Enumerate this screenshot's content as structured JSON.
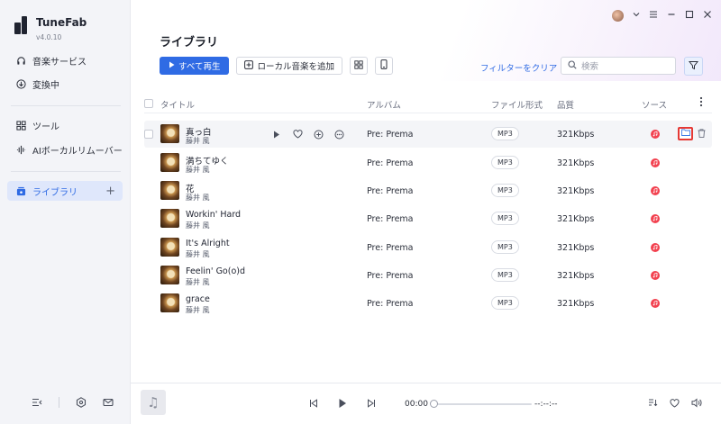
{
  "app": {
    "name": "TuneFab",
    "version": "v4.0.10"
  },
  "sidebar": {
    "items": [
      {
        "label": "音楽サービス"
      },
      {
        "label": "変換中"
      },
      {
        "label": "ツール"
      },
      {
        "label": "AIボーカルリムーバー"
      },
      {
        "label": "ライブラリ",
        "action": "+"
      }
    ]
  },
  "page": {
    "title": "ライブラリ"
  },
  "toolbar": {
    "play_all": "すべて再生",
    "add_local": "ローカル音楽を追加",
    "filter_clear": "フィルターをクリア",
    "search_placeholder": "検索"
  },
  "table": {
    "headers": {
      "title": "タイトル",
      "album": "アルバム",
      "format": "ファイル形式",
      "quality": "品質",
      "source": "ソース"
    },
    "rows": [
      {
        "title": "真っ白",
        "artist": "藤井 風",
        "album": "Pre: Prema",
        "format": "MP3",
        "quality": "321Kbps"
      },
      {
        "title": "満ちてゆく",
        "artist": "藤井 風",
        "album": "Pre: Prema",
        "format": "MP3",
        "quality": "321Kbps"
      },
      {
        "title": "花",
        "artist": "藤井 風",
        "album": "Pre: Prema",
        "format": "MP3",
        "quality": "321Kbps"
      },
      {
        "title": "Workin' Hard",
        "artist": "藤井 風",
        "album": "Pre: Prema",
        "format": "MP3",
        "quality": "321Kbps"
      },
      {
        "title": "It's Alright",
        "artist": "藤井 風",
        "album": "Pre: Prema",
        "format": "MP3",
        "quality": "321Kbps"
      },
      {
        "title": "Feelin' Go(o)d",
        "artist": "藤井 風",
        "album": "Pre: Prema",
        "format": "MP3",
        "quality": "321Kbps"
      },
      {
        "title": "grace",
        "artist": "藤井 風",
        "album": "Pre: Prema",
        "format": "MP3",
        "quality": "321Kbps"
      }
    ]
  },
  "player": {
    "time_current": "00:00",
    "time_total": "--:--:--"
  },
  "colors": {
    "accent": "#2f6be4",
    "source_red": "#f2414f",
    "highlight": "#e53935"
  }
}
